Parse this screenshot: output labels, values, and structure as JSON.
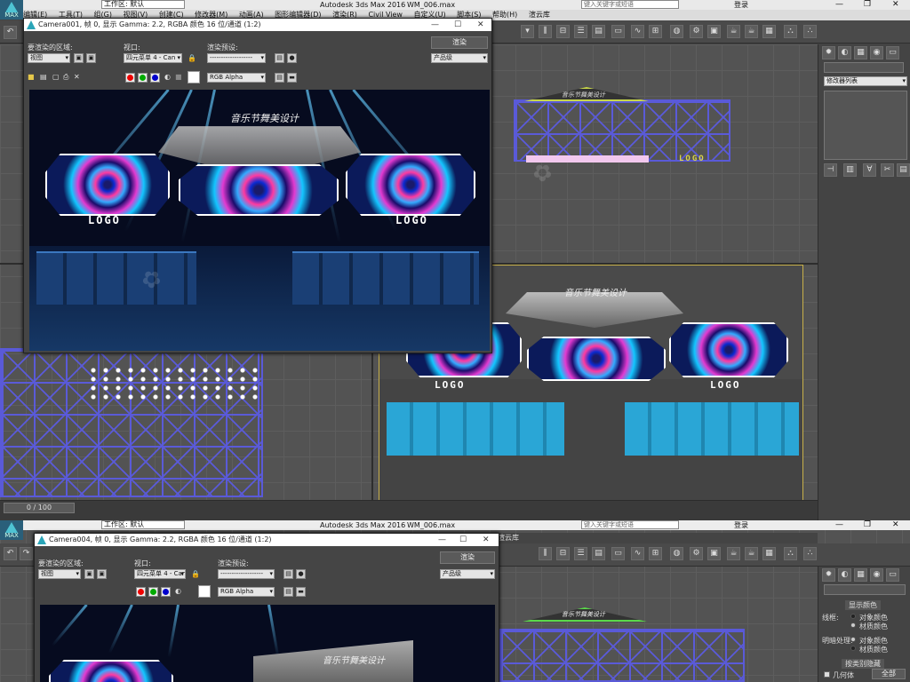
{
  "window1": {
    "logo_label": "MAX",
    "workspace": "工作区: 默认",
    "app_title": "Autodesk 3ds Max 2016",
    "file_name": "WM_006.max",
    "search_placeholder": "键入关键字或短语",
    "login": "登录",
    "menu": [
      "编辑(E)",
      "工具(T)",
      "组(G)",
      "视图(V)",
      "创建(C)",
      "修改器(M)",
      "动画(A)",
      "图形编辑器(D)",
      "渲染(R)",
      "Civil View",
      "自定义(U)",
      "脚本(S)",
      "帮助(H)",
      "渲云库"
    ],
    "timeslider": "0 / 100",
    "cmd_dropdown": "修改器列表"
  },
  "render1": {
    "title": "Camera001, 帧 0, 显示 Gamma: 2.2, RGBA 颜色 16 位/通道 (1:2)",
    "area_label": "要渲染的区域:",
    "area_value": "视图",
    "viewport_label": "视口:",
    "viewport_value": "四元菜单 4 - Can",
    "preset_label": "渲染预设:",
    "preset_value": "-------------------",
    "render_button": "渲染",
    "quality_value": "产品级",
    "channel_value": "RGB Alpha",
    "stage_title": "音乐节舞美设计",
    "logo_left": "LOGO",
    "logo_right": "LOGO"
  },
  "viewport": {
    "top_stage_title": "音乐节舞美设计",
    "top_logo": "LOGO",
    "persp_stage_title": "音乐节舞美设计",
    "persp_logo_left": "LOGO",
    "persp_logo_right": "LOGO"
  },
  "window2": {
    "logo_label": "MAX",
    "workspace": "工作区: 默认",
    "app_title": "Autodesk 3ds Max 2016",
    "file_name": "WM_006.max",
    "search_placeholder": "键入关键字或短语",
    "login": "登录",
    "menu_tail": "渲云库"
  },
  "render2": {
    "title": "Camera004, 帧 0, 显示 Gamma: 2.2, RGBA 颜色 16 位/通道 (1:2)",
    "area_label": "要渲染的区域:",
    "area_value": "视图",
    "viewport_label": "视口:",
    "viewport_value": "四元菜单 4 - Can",
    "preset_label": "渲染预设:",
    "preset_value": "-------------------",
    "render_button": "渲染",
    "quality_value": "产品级",
    "channel_value": "RGB Alpha",
    "stage_title": "音乐节舞美设计"
  },
  "cmdpanel2": {
    "section_display_color": "显示颜色",
    "wireframe_label": "线框:",
    "shaded_label": "明暗处理:",
    "object_color": "对象颜色",
    "material_color": "材质颜色",
    "hide_by_category": "按类别隐藏",
    "geometry": "几何体",
    "all": "全部"
  }
}
